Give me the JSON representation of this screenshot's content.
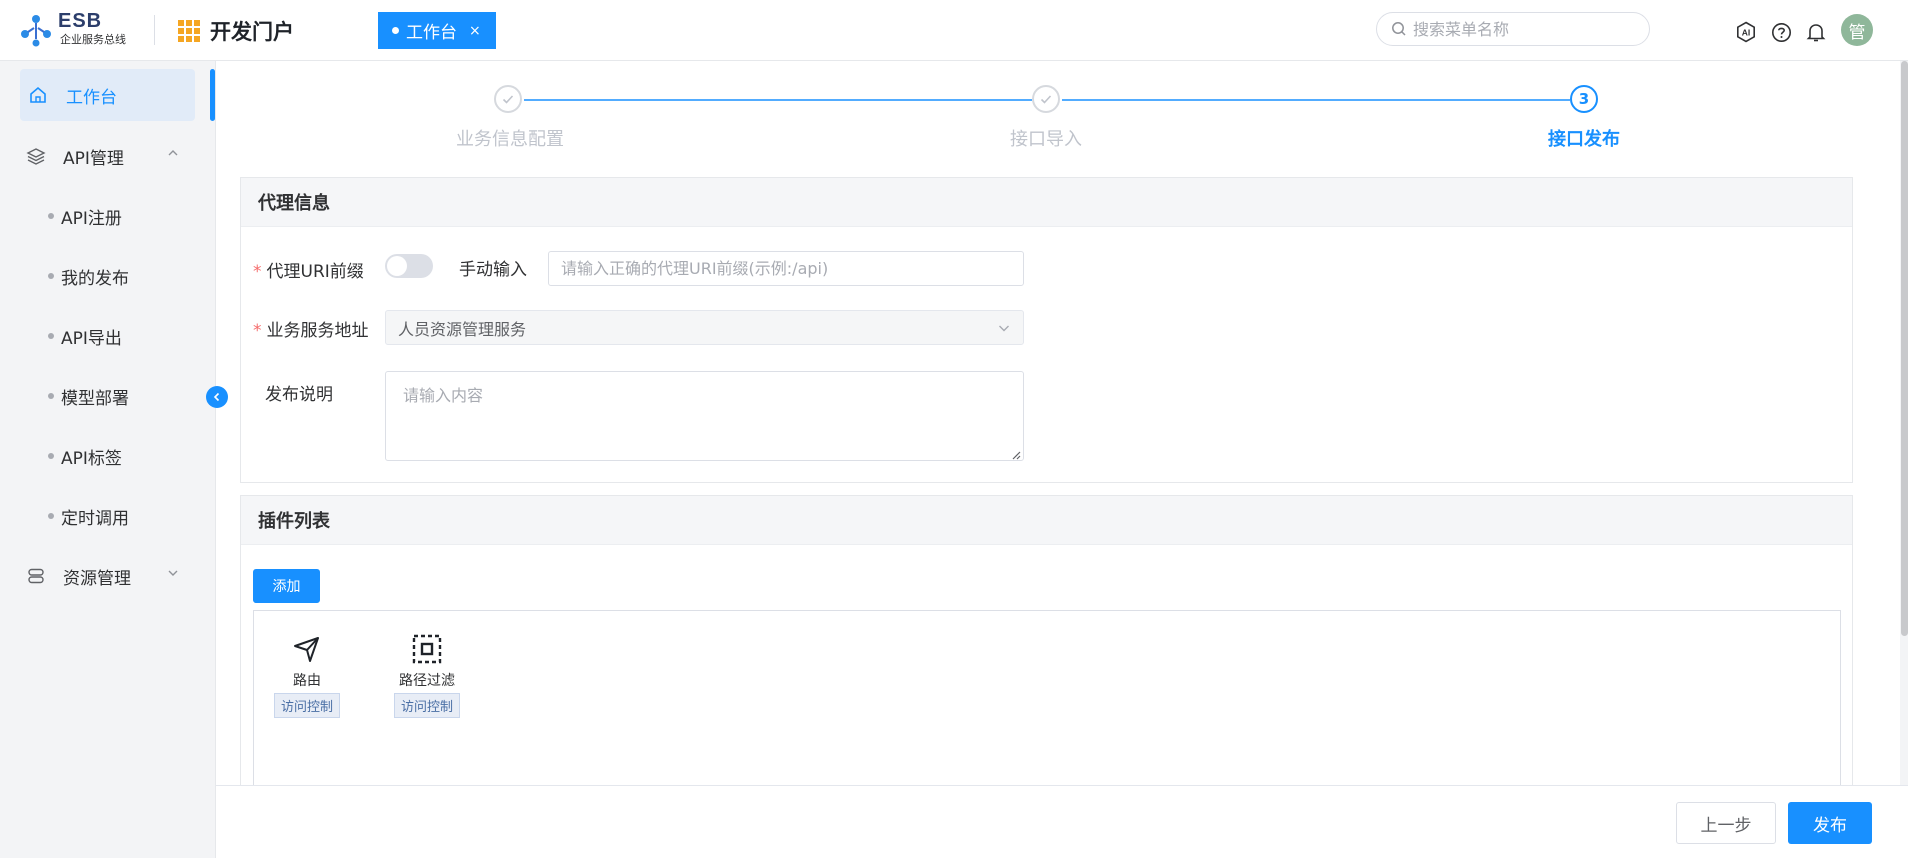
{
  "header": {
    "logo_title": "ESB",
    "logo_subtitle": "企业服务总线",
    "portal_title": "开发门户",
    "active_tab": "工作台",
    "tab_close": "×",
    "search_placeholder": "搜索菜单名称",
    "avatar_text": "管",
    "icons": [
      "ai-icon",
      "help-icon",
      "bell-icon"
    ]
  },
  "sidebar": {
    "active_item": "工作台",
    "groups": [
      {
        "label": "API管理",
        "expanded": true
      },
      {
        "label": "资源管理",
        "expanded": false
      }
    ],
    "items": [
      "API注册",
      "我的发布",
      "API导出",
      "模型部署",
      "API标签",
      "定时调用"
    ]
  },
  "steps": [
    {
      "label": "业务信息配置",
      "status": "done"
    },
    {
      "label": "接口导入",
      "status": "done"
    },
    {
      "label": "接口发布",
      "status": "current",
      "number": "3"
    }
  ],
  "proxy_panel": {
    "title": "代理信息",
    "uri_prefix_label": "代理URI前缀",
    "manual_input_label": "手动输入",
    "uri_placeholder": "请输入正确的代理URI前缀(示例:/api)",
    "service_address_label": "业务服务地址",
    "service_address_value": "人员资源管理服务",
    "publish_desc_label": "发布说明",
    "publish_desc_placeholder": "请输入内容",
    "required_mark": "*"
  },
  "plugin_panel": {
    "title": "插件列表",
    "add_label": "添加",
    "plugins": [
      {
        "name": "路由",
        "tag": "访问控制",
        "icon": "send-icon"
      },
      {
        "name": "路径过滤",
        "tag": "访问控制",
        "icon": "filter-box-icon"
      }
    ]
  },
  "footer": {
    "prev_label": "上一步",
    "publish_label": "发布"
  },
  "colors": {
    "primary": "#1890ff",
    "required": "#f56c6c",
    "logo_accent": "#f5a623"
  }
}
